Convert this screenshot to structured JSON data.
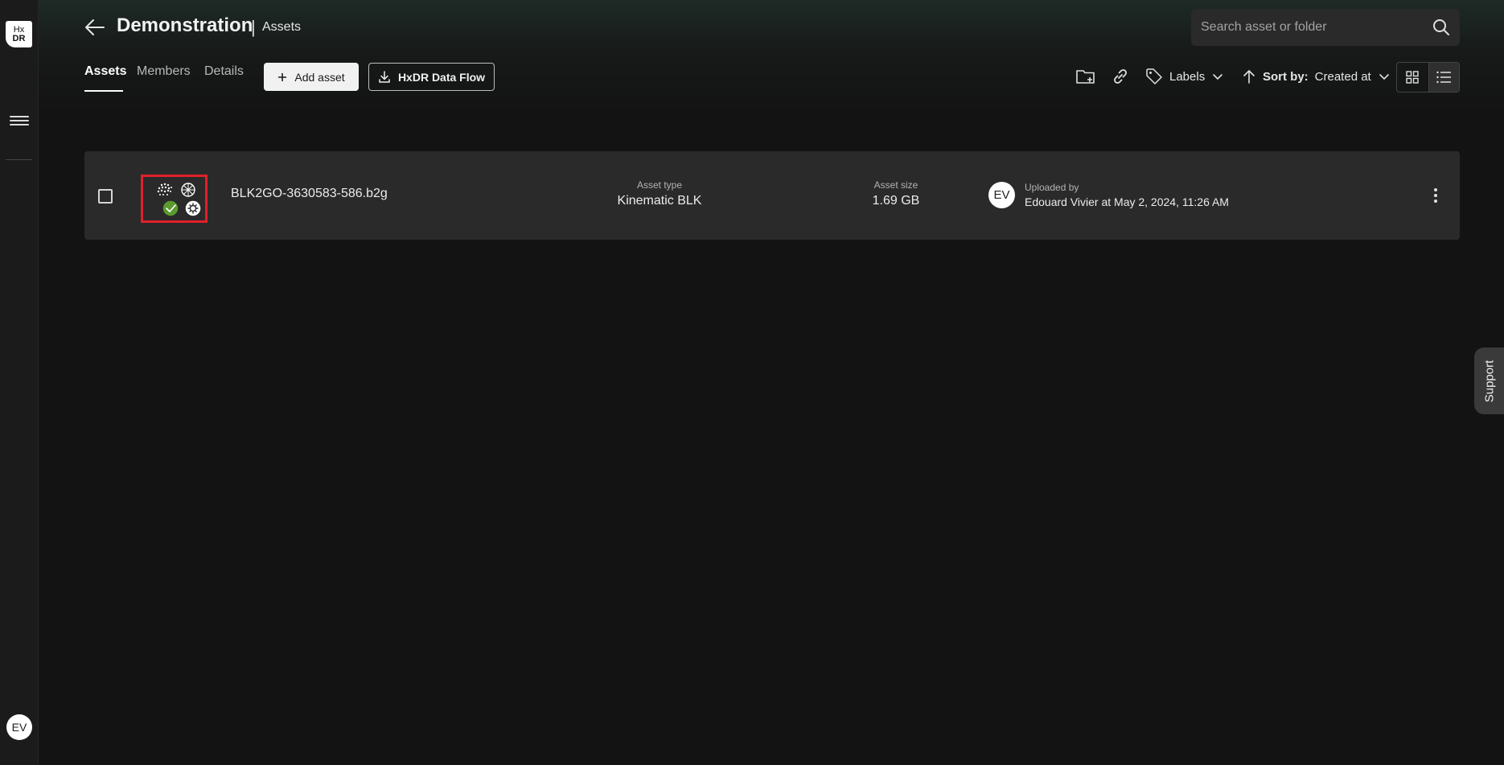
{
  "rail": {
    "logo_line1": "Hx",
    "logo_line2": "DR",
    "avatar_initials": "EV"
  },
  "header": {
    "title": "Demonstration",
    "separator": "|",
    "breadcrumb": "Assets"
  },
  "search": {
    "placeholder": "Search asset or folder"
  },
  "tabs": [
    {
      "label": "Assets",
      "active": true
    },
    {
      "label": "Members",
      "active": false
    },
    {
      "label": "Details",
      "active": false
    }
  ],
  "actions": {
    "add_asset_label": "Add asset",
    "data_flow_label": "HxDR Data Flow"
  },
  "toolbar": {
    "labels_label": "Labels",
    "sort_prefix": "Sort by:",
    "sort_value": "Created at"
  },
  "asset": {
    "name": "BLK2GO-3630583-586.b2g",
    "type_label": "Asset type",
    "type_value": "Kinematic BLK",
    "size_label": "Asset size",
    "size_value": "1.69 GB",
    "uploader_initials": "EV",
    "uploaded_label": "Uploaded by",
    "uploaded_value": "Edouard Vivier at May 2, 2024, 11:26 AM"
  },
  "support": {
    "label": "Support"
  },
  "colors": {
    "highlight": "#e0202a",
    "status_ok": "#5a9a2f"
  }
}
